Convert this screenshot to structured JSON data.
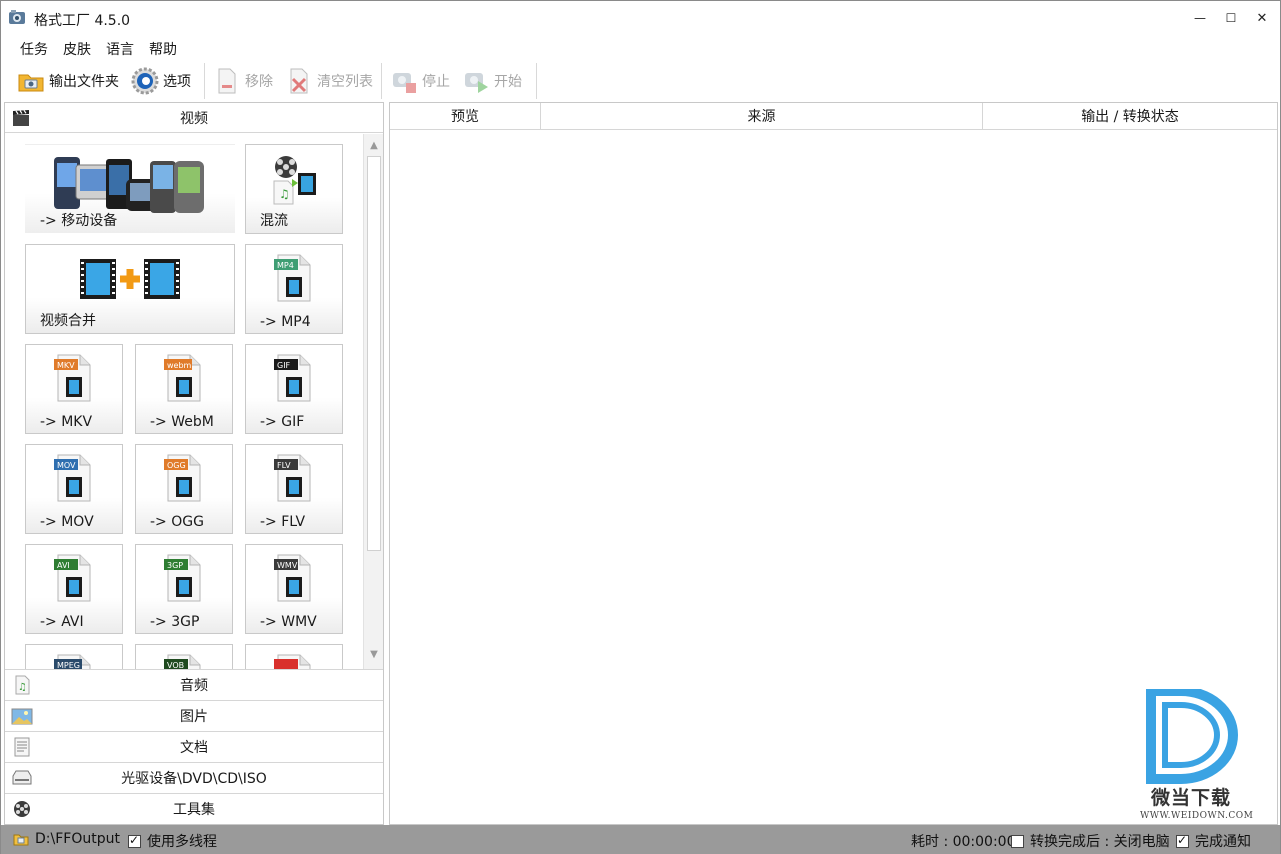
{
  "window": {
    "title": "格式工厂 4.5.0",
    "controls": {
      "minimize": "—",
      "maximize": "☐",
      "close": "✕"
    }
  },
  "menu": [
    "任务",
    "皮肤",
    "语言",
    "帮助"
  ],
  "toolbar": {
    "output_folder": "输出文件夹",
    "options": "选项",
    "remove": "移除",
    "clear_list": "清空列表",
    "stop": "停止",
    "start": "开始"
  },
  "categories": {
    "video": "视频",
    "audio": "音频",
    "picture": "图片",
    "document": "文档",
    "rom": "光驱设备\\DVD\\CD\\ISO",
    "tools": "工具集"
  },
  "video_tiles": [
    {
      "label": "-> 移动设备",
      "icon": "mobile-devices-icon"
    },
    {
      "label": "混流",
      "icon": "mux-icon"
    },
    {
      "label": "视频合并",
      "icon": "video-join-icon"
    },
    {
      "label": "-> MP4",
      "icon": "mp4-file-icon",
      "badge": "MP4"
    },
    {
      "label": "-> MKV",
      "icon": "mkv-file-icon",
      "badge": "MKV"
    },
    {
      "label": "-> WebM",
      "icon": "webm-file-icon",
      "badge": "webm"
    },
    {
      "label": "-> GIF",
      "icon": "gif-file-icon",
      "badge": "GIF"
    },
    {
      "label": "-> MOV",
      "icon": "mov-file-icon",
      "badge": "MOV"
    },
    {
      "label": "-> OGG",
      "icon": "ogg-file-icon",
      "badge": "OGG"
    },
    {
      "label": "-> FLV",
      "icon": "flv-file-icon",
      "badge": "FLV"
    },
    {
      "label": "-> AVI",
      "icon": "avi-file-icon",
      "badge": "AVI"
    },
    {
      "label": "-> 3GP",
      "icon": "3gp-file-icon",
      "badge": "3GP"
    },
    {
      "label": "-> WMV",
      "icon": "wmv-file-icon",
      "badge": "WMV"
    },
    {
      "label": "",
      "icon": "mpeg-file-icon",
      "badge": "MPEG"
    },
    {
      "label": "",
      "icon": "vob-file-icon",
      "badge": "VOB"
    },
    {
      "label": "",
      "icon": "swf-file-icon",
      "badge": ""
    }
  ],
  "task_table": {
    "columns": [
      "预览",
      "来源",
      "输出 / 转换状态"
    ]
  },
  "watermark": {
    "brand": "微当下载",
    "url": "WWW.WEIDOWN.COM"
  },
  "statusbar": {
    "output_path": "D:\\FFOutput",
    "multithread_label": "使用多线程",
    "multithread_checked": true,
    "elapsed": "耗时 : 00:00:00",
    "after_done_label": "转换完成后 : 关闭电脑",
    "after_done_checked": false,
    "notify_label": "完成通知",
    "notify_checked": true
  },
  "colors": {
    "statusbar_bg": "#9a9a9a",
    "accent_blue": "#2b8fd6",
    "watermark_blue": "#3aa3e3"
  }
}
